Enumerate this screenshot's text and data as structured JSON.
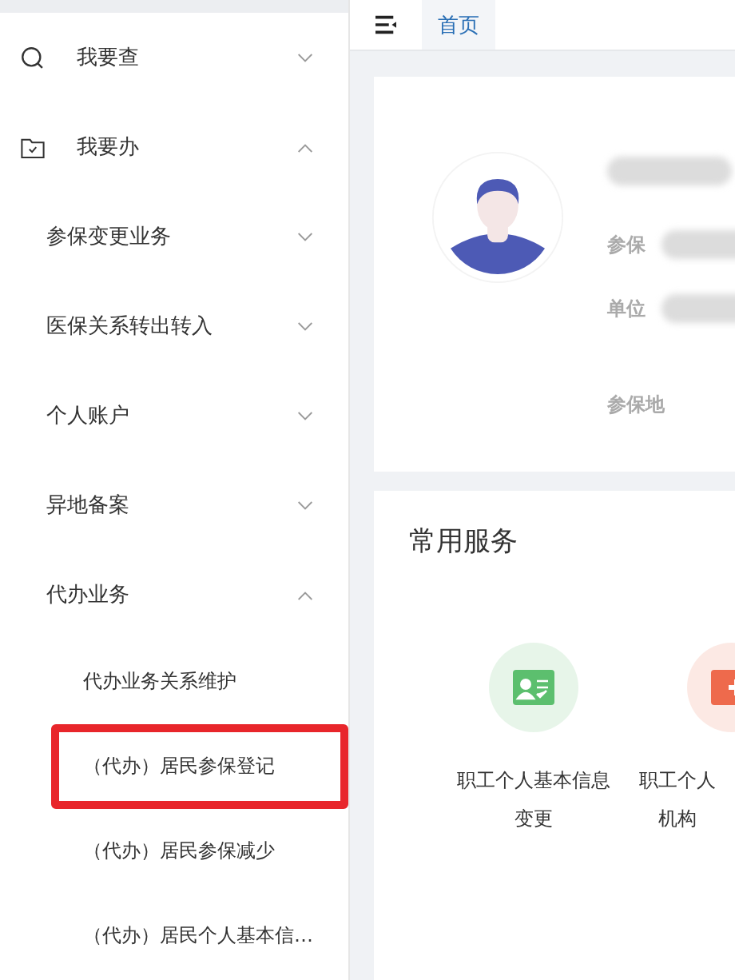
{
  "sidebar": {
    "menu": [
      {
        "label": "我要查",
        "expanded": false
      },
      {
        "label": "我要办",
        "expanded": true,
        "children": [
          {
            "label": "参保变更业务",
            "expanded": false
          },
          {
            "label": "医保关系转出转入",
            "expanded": false
          },
          {
            "label": "个人账户",
            "expanded": false
          },
          {
            "label": "异地备案",
            "expanded": false
          },
          {
            "label": "代办业务",
            "expanded": true,
            "children": [
              {
                "label": "代办业务关系维护",
                "highlighted": false
              },
              {
                "label": "（代办）居民参保登记",
                "highlighted": true
              },
              {
                "label": "（代办）居民参保减少",
                "highlighted": false
              },
              {
                "label": "（代办）居民个人基本信…",
                "highlighted": false
              }
            ]
          }
        ]
      }
    ]
  },
  "tabs": [
    {
      "label": "首页",
      "selected": true
    }
  ],
  "profile": {
    "fields": [
      {
        "label": "参保"
      },
      {
        "label": "单位"
      },
      {
        "label": "参保地"
      }
    ]
  },
  "services": {
    "title": "常用服务",
    "items": [
      {
        "lines": [
          "职工个人基本信息",
          "变更"
        ],
        "color": "#5cbf6e"
      },
      {
        "lines": [
          "职工个人",
          "机构"
        ],
        "color": "#ee6a4c"
      }
    ]
  }
}
